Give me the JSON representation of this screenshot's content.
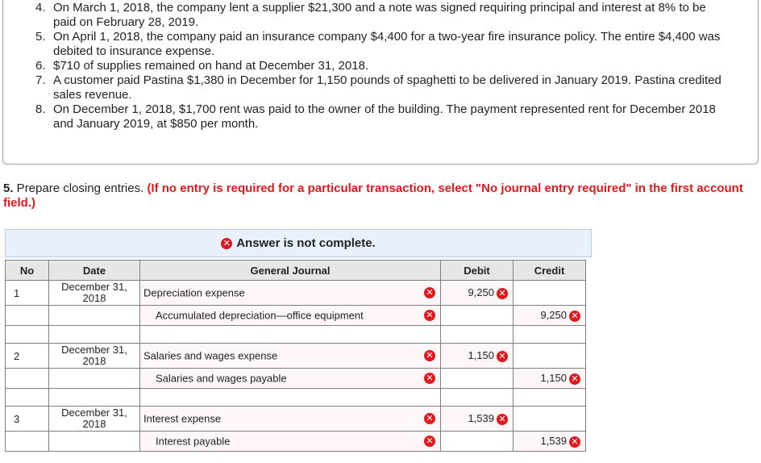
{
  "instructions": [
    {
      "num": "4.",
      "text": "On March 1, 2018, the company lent a supplier $21,300 and a note was signed requiring principal and interest at 8% to be paid on February 28, 2019."
    },
    {
      "num": "5.",
      "text": "On April 1, 2018, the company paid an insurance company $4,400 for a two-year fire insurance policy. The entire $4,400 was debited to insurance expense."
    },
    {
      "num": "6.",
      "text": "$710 of supplies remained on hand at December 31, 2018."
    },
    {
      "num": "7.",
      "text": "A customer paid Pastina $1,380 in December for 1,150 pounds of spaghetti to be delivered in January 2019. Pastina credited sales revenue."
    },
    {
      "num": "8.",
      "text": "On December 1, 2018, $1,700 rent was paid to the owner of the building. The payment represented rent for December 2018 and January 2019, at $850 per month."
    }
  ],
  "requirement": {
    "number": "5.",
    "text": " Prepare closing entries. ",
    "note": "(If no entry is required for a particular transaction, select \"No journal entry required\" in the first account field.)"
  },
  "banner": {
    "text": "Answer is not complete."
  },
  "table": {
    "headers": {
      "no": "No",
      "date": "Date",
      "journal": "General Journal",
      "debit": "Debit",
      "credit": "Credit"
    },
    "entries": [
      {
        "no": "1",
        "date": "December 31, 2018",
        "debit_account": "Depreciation expense",
        "debit_amount": "9,250",
        "credit_account": "Accumulated depreciation—office equipment",
        "credit_amount": "9,250"
      },
      {
        "no": "2",
        "date": "December 31, 2018",
        "debit_account": "Salaries and wages expense",
        "debit_amount": "1,150",
        "credit_account": "Salaries and wages payable",
        "credit_amount": "1,150"
      },
      {
        "no": "3",
        "date": "December 31, 2018",
        "debit_account": "Interest expense",
        "debit_amount": "1,539",
        "credit_account": "Interest payable",
        "credit_amount": "1,539"
      }
    ]
  },
  "icons": {
    "error": "x-circle-icon"
  },
  "colors": {
    "error": "#e0191e",
    "banner_bg": "#e8f1fb",
    "header_bg": "#e6e6e6"
  }
}
